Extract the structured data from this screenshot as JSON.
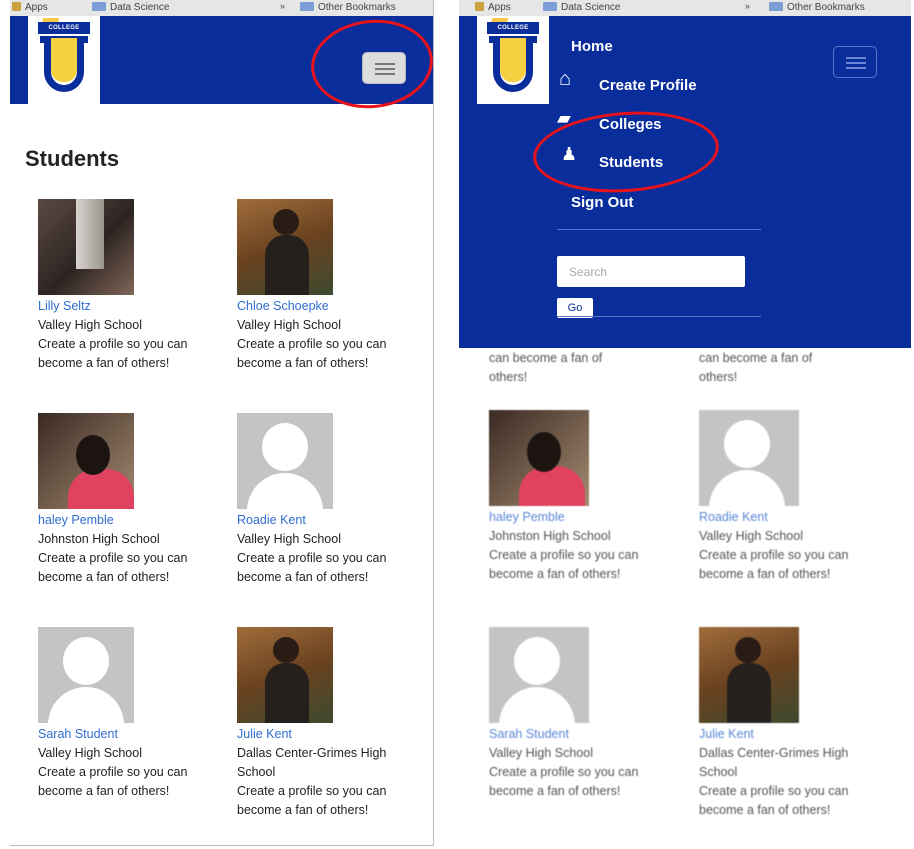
{
  "bookmarks": {
    "apps": "Apps",
    "data_science": "Data Science",
    "other": "Other Bookmarks"
  },
  "logo": {
    "banner": "COLLEGE RECRUIT"
  },
  "page_title": "Students",
  "students": [
    {
      "name": "Lilly Seltz",
      "school": "Valley High School",
      "bio": "Create a profile so you can become a fan of others!"
    },
    {
      "name": "Chloe Schoepke",
      "school": "Valley High School",
      "bio": "Create a profile so you can become a fan of others!"
    },
    {
      "name": "haley Pemble",
      "school": "Johnston High School",
      "bio": "Create a profile so you can become a fan of others!"
    },
    {
      "name": "Roadie Kent",
      "school": "Valley High School",
      "bio": "Create a profile so you can become a fan of others!"
    },
    {
      "name": "Sarah Student",
      "school": "Valley High School",
      "bio": "Create a profile so you can become a fan of others!"
    },
    {
      "name": "Julie Kent",
      "school": "Dallas Center-Grimes High School",
      "bio": "Create a profile so you can become a fan of others!"
    }
  ],
  "overlay_fragment": "can become a fan of others!",
  "menu": {
    "home": "Home",
    "create_profile": "Create Profile",
    "colleges": "Colleges",
    "students": "Students",
    "sign_out": "Sign Out",
    "search_placeholder": "Search",
    "go_label": "Go"
  },
  "icons": {
    "menu_toggle": "hamburger-icon",
    "create_profile": "home-icon",
    "colleges": "graduation-cap-icon",
    "students": "user-icon"
  },
  "colors": {
    "navbar": "#0a2d9c",
    "link": "#2f6ed0",
    "annotation": "#e8131a"
  }
}
